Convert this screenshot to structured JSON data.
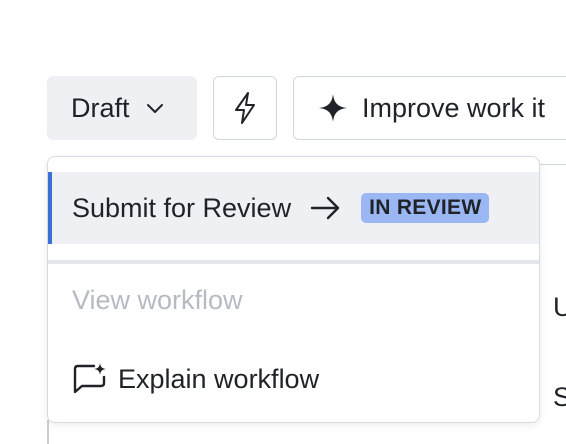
{
  "toolbar": {
    "status_label": "Draft",
    "improve_label": "Improve work it"
  },
  "background_rows": [
    "U",
    "S"
  ],
  "menu": {
    "transition": {
      "label": "Submit for Review",
      "target_status": "IN REVIEW"
    },
    "view_workflow_label": "View workflow",
    "explain_workflow_label": "Explain workflow"
  },
  "colors": {
    "accent": "#3b6fd6",
    "badge_bg": "#9ab7f3",
    "status_button_bg": "#eef0f3",
    "disabled_text": "#b6bbc3"
  },
  "icons": [
    "chevron-down-icon",
    "lightning-icon",
    "sparkle-icon",
    "arrow-right-icon",
    "ai-chat-icon"
  ]
}
